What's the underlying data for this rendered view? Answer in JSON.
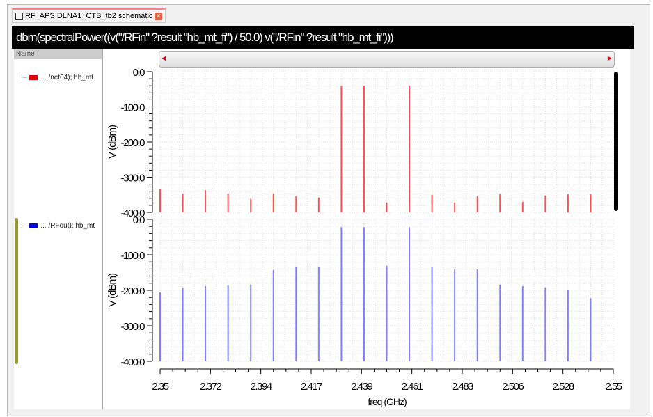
{
  "tab": {
    "title": "RF_APS DLNA1_CTB_tb2 schematic",
    "close_icon": "close-icon"
  },
  "plot_title": "dbm(spectralPower((v(\"/RFin\" ?result \"hb_mt_fi\") / 50.0) v(\"/RFin\" ?result \"hb_mt_fi\")))",
  "panel": {
    "header": "Name",
    "items": [
      {
        "label": "... /net04); hb_mt",
        "color": "#e00000"
      },
      {
        "label": "... /RFout); hb_mt",
        "color": "#0000e0"
      }
    ]
  },
  "chart_data": {
    "type": "bar",
    "xlabel": "freq (GHz)",
    "xlim": [
      2.35,
      2.55
    ],
    "xticks": [
      "2.35",
      "2.372",
      "2.394",
      "2.417",
      "2.439",
      "2.461",
      "2.483",
      "2.506",
      "2.528",
      "2.55"
    ],
    "x": [
      2.35,
      2.36,
      2.37,
      2.38,
      2.39,
      2.4,
      2.41,
      2.42,
      2.43,
      2.44,
      2.45,
      2.46,
      2.47,
      2.48,
      2.49,
      2.5,
      2.51,
      2.52,
      2.53,
      2.54
    ],
    "strips": [
      {
        "name": "/net04",
        "ylabel": "V (dBm)",
        "ylim": [
          -400,
          0
        ],
        "yticks": [
          "0.0",
          "-100.0",
          "-200.0",
          "-300.0",
          "-400.0"
        ],
        "color": "#ff5050",
        "values": [
          -335,
          -347,
          -337,
          -347,
          -362,
          -347,
          -354,
          -358,
          -40,
          -40,
          -372,
          -40,
          -350,
          -372,
          -354,
          -348,
          -370,
          -352,
          -348,
          -348
        ]
      },
      {
        "name": "/RFout",
        "ylabel": "V (dBm)",
        "ylim": [
          -400,
          0
        ],
        "yticks": [
          "0.0",
          "-100.0",
          "-200.0",
          "-300.0",
          "-400.0"
        ],
        "color": "#8080ff",
        "values": [
          -206,
          -192,
          -188,
          -186,
          -184,
          -143,
          -135,
          -135,
          -22,
          -22,
          -131,
          -22,
          -135,
          -141,
          -141,
          -184,
          -188,
          -192,
          -198,
          -222
        ]
      }
    ]
  }
}
